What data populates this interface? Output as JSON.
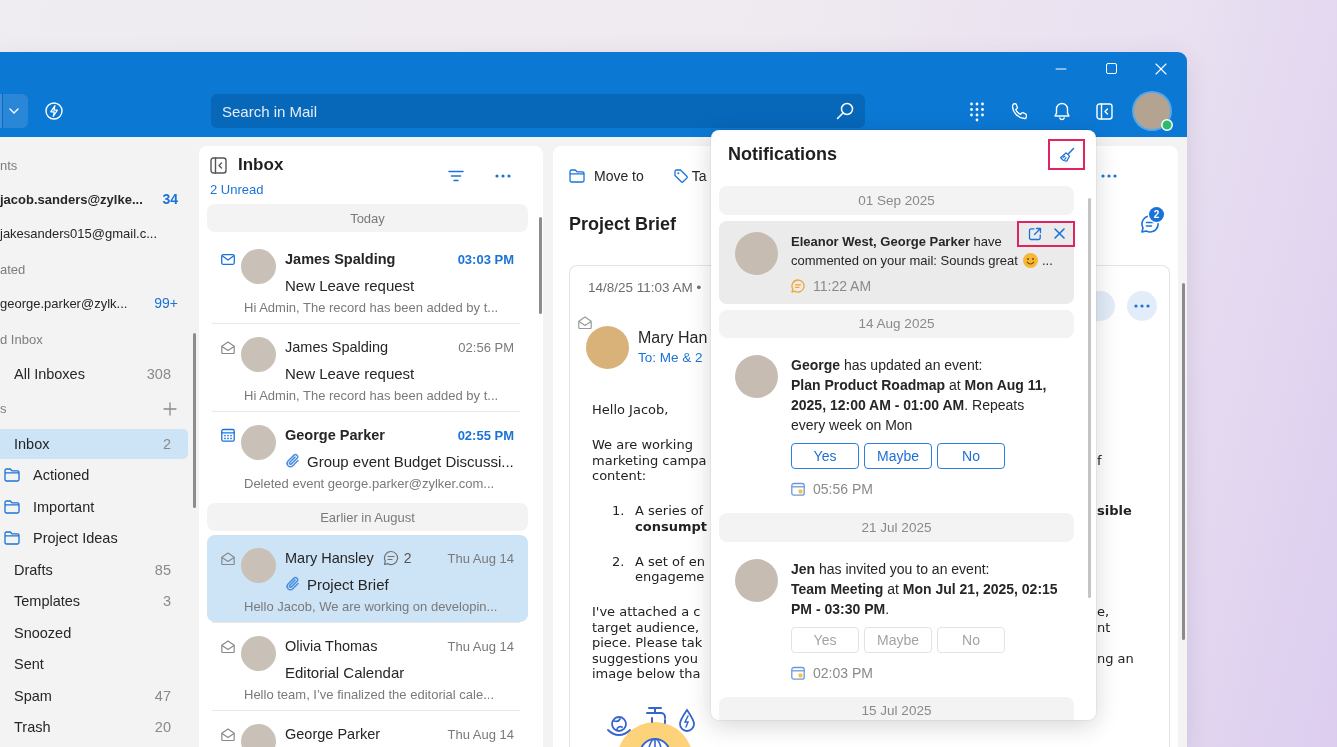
{
  "title_bar": {
    "search": {
      "placeholder": "Search in Mail"
    },
    "profile": {
      "online": true
    }
  },
  "sidebar": {
    "items": [
      {
        "kind": "section",
        "label": "nts",
        "can_add": false
      },
      {
        "kind": "account",
        "label": "jacob.sanders@zylke...",
        "count": "34",
        "current": true
      },
      {
        "kind": "account",
        "label": "jakesanders015@gmail.c...",
        "current": false
      },
      {
        "kind": "section",
        "label": "ated",
        "can_add": false
      },
      {
        "kind": "account",
        "label": "george.parker@zylk...",
        "count": "99+",
        "current": false
      },
      {
        "kind": "section",
        "label": "d Inbox",
        "can_add": false
      },
      {
        "kind": "folder",
        "label": "All Inboxes",
        "count": "308",
        "selected": false
      },
      {
        "kind": "section",
        "label": "s",
        "can_add": true
      },
      {
        "kind": "folder",
        "label": "Inbox",
        "count": "2",
        "selected": true,
        "children": [
          {
            "kind": "folder",
            "label": "Actioned",
            "selected": false
          },
          {
            "kind": "folder",
            "label": "Important",
            "selected": false
          },
          {
            "kind": "folder",
            "label": "Project Ideas",
            "selected": false
          }
        ]
      },
      {
        "kind": "folder",
        "label": "Drafts",
        "count": "85",
        "selected": false
      },
      {
        "kind": "folder",
        "label": "Templates",
        "count": "3",
        "selected": false
      },
      {
        "kind": "folder",
        "label": "Snoozed",
        "selected": false
      },
      {
        "kind": "folder",
        "label": "Sent",
        "selected": false
      },
      {
        "kind": "folder",
        "label": "Spam",
        "count": "47",
        "selected": false
      },
      {
        "kind": "folder",
        "label": "Trash",
        "count": "20",
        "selected": false
      }
    ]
  },
  "mail_list": {
    "title": "Inbox",
    "unread_count": "2 Unread",
    "groups": [
      {
        "label": "Today",
        "mails": [
          {
            "kind": "mail",
            "sender": "James Spalding",
            "time": "03:03 PM",
            "subject": "New Leave request",
            "preview": "Hi Admin, The record has been added by t...",
            "unread": true,
            "attachment": false,
            "selected": false
          },
          {
            "kind": "mail",
            "sender": "James Spalding",
            "time": "02:56 PM",
            "subject": "New Leave request",
            "preview": "Hi Admin, The record has been added by t...",
            "unread": false,
            "attachment": false,
            "selected": false
          },
          {
            "kind": "event",
            "sender": "George Parker",
            "time": "02:55 PM",
            "subject": "Group event Budget Discussi...",
            "preview": "Deleted event george.parker@zylker.com...",
            "unread": true,
            "attachment": true,
            "selected": false
          }
        ]
      },
      {
        "label": "Earlier in August",
        "mails": [
          {
            "kind": "mail",
            "sender": "Mary Hansley",
            "comments": "2",
            "time": "Thu Aug 14",
            "subject": "Project Brief",
            "preview": "Hello Jacob, We are working on developin...",
            "unread": false,
            "attachment": true,
            "selected": true
          },
          {
            "kind": "mail",
            "sender": "Olivia Thomas",
            "time": "Thu Aug 14",
            "subject": "Editorial Calendar",
            "preview": "Hello team, I’ve finalized the editorial cale...",
            "unread": false,
            "attachment": false,
            "selected": false
          },
          {
            "kind": "mail",
            "sender": "George Parker",
            "time": "Thu Aug 14",
            "unread": false,
            "selected": false
          }
        ]
      }
    ]
  },
  "reading_pane": {
    "actions": [
      {
        "kind": "folder",
        "label": "Move to"
      },
      {
        "kind": "tag",
        "label": "Ta"
      }
    ],
    "subject": "Project Brief",
    "comment_count": "2",
    "message": {
      "date": "14/8/25 11:03 AM •",
      "sender": "Mary Han",
      "recipients": "To: Me & 2",
      "body": [
        {
          "kind": "paragraph",
          "lines": [
            {
              "left": {
                "text": "Hello Jacob,",
                "bold": false
              }
            }
          ]
        },
        {
          "kind": "paragraph",
          "lines": [
            {
              "left": {
                "text": "We are working",
                "bold": false
              }
            },
            {
              "left": {
                "text": "marketing campa",
                "bold": false
              },
              "right": {
                "text": "f",
                "bold": false
              }
            },
            {
              "left": {
                "text": "content:",
                "bold": false
              }
            }
          ]
        },
        {
          "kind": "list_item",
          "number": "1.",
          "lines": [
            {
              "left": {
                "text": "A series of",
                "bold": false
              },
              "right": {
                "text": "sible",
                "bold": true
              }
            },
            {
              "left": {
                "text": "consumpt",
                "bold": true
              }
            }
          ]
        },
        {
          "kind": "list_item",
          "number": "2.",
          "lines": [
            {
              "left": {
                "text": "A set of en",
                "bold": false
              }
            },
            {
              "left": {
                "text": "engageme",
                "bold": false
              }
            }
          ]
        },
        {
          "kind": "paragraph",
          "lines": [
            {
              "left": {
                "text": "I've attached a c",
                "bold": false
              },
              "right": {
                "text": "e,",
                "bold": false
              }
            },
            {
              "left": {
                "text": "target audience,",
                "bold": false
              },
              "right": {
                "text": "nt",
                "bold": false
              }
            },
            {
              "left": {
                "text": "piece. Please tak",
                "bold": false
              }
            },
            {
              "left": {
                "text": "suggestions you",
                "bold": false
              },
              "right": {
                "text": "ng an",
                "bold": false
              }
            },
            {
              "left": {
                "text": "image below tha",
                "bold": false
              }
            }
          ]
        },
        {
          "kind": "illustration"
        }
      ]
    }
  },
  "notifications": {
    "title": "Notifications",
    "clear_all": {
      "highlighted": true
    },
    "groups": [
      {
        "date": "01 Sep 2025",
        "items": [
          {
            "kind": "comment",
            "text": "**Eleanor West, George Parker** have commented on your mail: Sounds great",
            "emoji": true,
            "truncation": "...",
            "time": "11:22 AM",
            "hovered": true,
            "actions_highlighted": true
          }
        ]
      },
      {
        "date": "14 Aug 2025",
        "items": [
          {
            "kind": "event",
            "text": "**George** has updated an event:\n**Plan Product Roadmap** at **Mon Aug 11, 2025, 12:00 AM - 01:00 AM**. Repeats every week on Mon",
            "responses": [
              {
                "label": "Yes",
                "disabled": false
              },
              {
                "label": "Maybe",
                "disabled": false
              },
              {
                "label": "No",
                "disabled": false
              }
            ],
            "time": "05:56 PM",
            "hovered": false
          }
        ]
      },
      {
        "date": "21 Jul 2025",
        "items": [
          {
            "kind": "event",
            "text": "**Jen** has invited you to an event:\n**Team Meeting** at **Mon Jul 21, 2025, 02:15 PM - 03:30 PM**.",
            "responses": [
              {
                "label": "Yes",
                "disabled": true
              },
              {
                "label": "Maybe",
                "disabled": true
              },
              {
                "label": "No",
                "disabled": true
              }
            ],
            "time": "02:03 PM",
            "hovered": false
          }
        ]
      },
      {
        "date": "15 Jul 2025"
      }
    ]
  }
}
